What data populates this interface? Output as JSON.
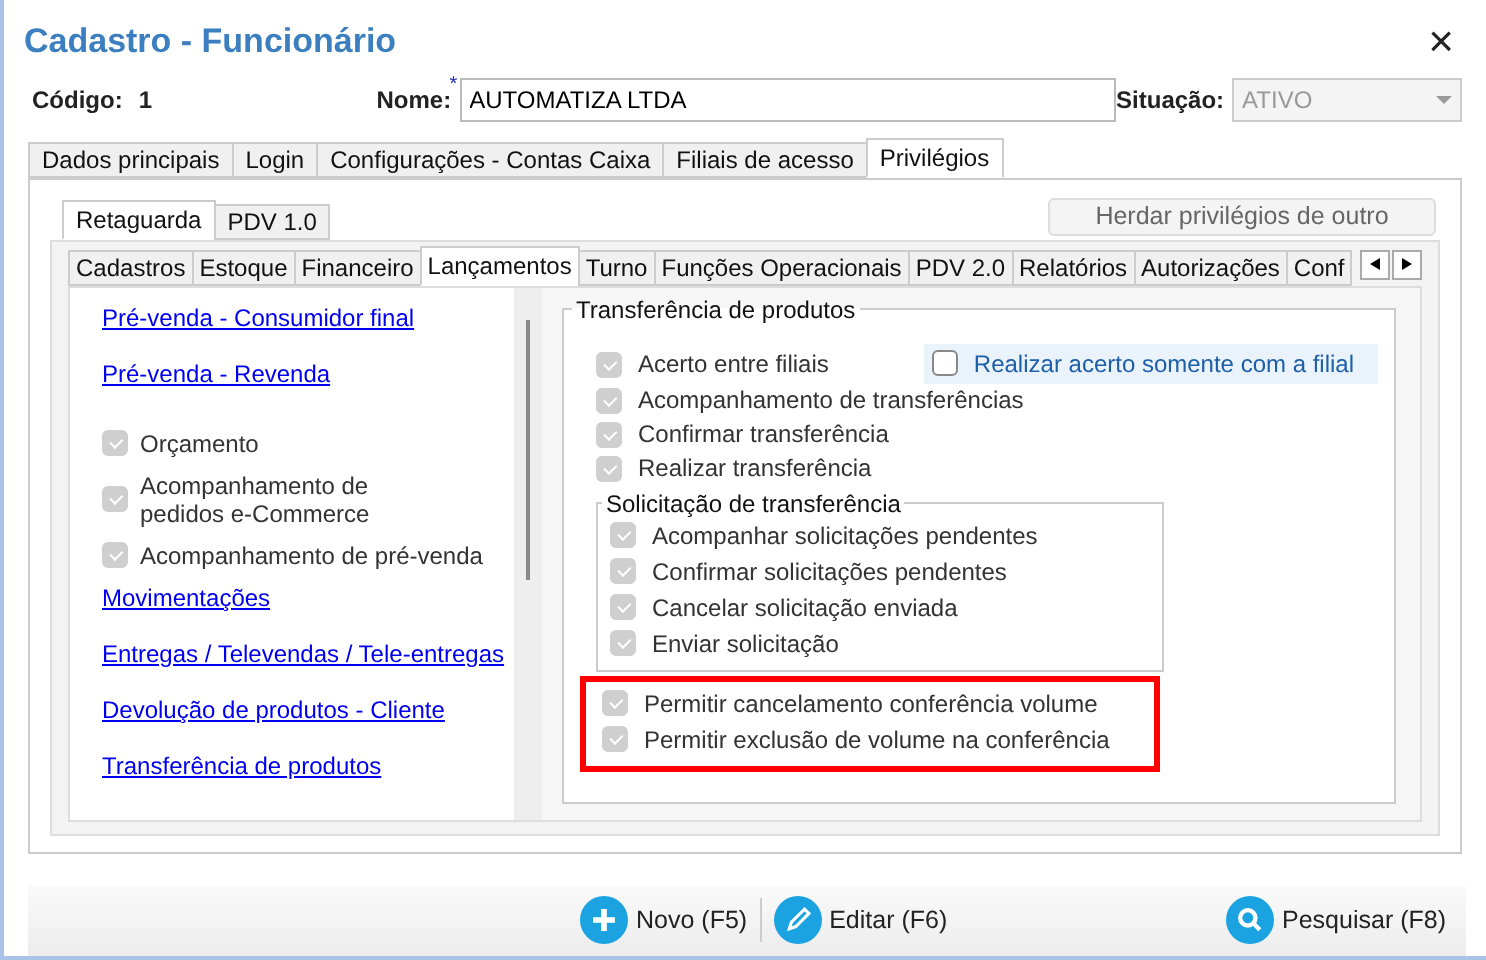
{
  "window": {
    "title": "Cadastro - Funcionário",
    "close": "×"
  },
  "fields": {
    "codigo_label": "Código:",
    "codigo_value": "1",
    "nome_label": "Nome:",
    "nome_required": "*",
    "nome_value": "AUTOMATIZA LTDA",
    "situacao_label": "Situação:",
    "situacao_value": "ATIVO"
  },
  "tabs": [
    {
      "label": "Dados principais",
      "selected": false
    },
    {
      "label": "Login",
      "selected": false
    },
    {
      "label": "Configurações - Contas Caixa",
      "selected": false
    },
    {
      "label": "Filiais de acesso",
      "selected": false
    },
    {
      "label": "Privilégios",
      "selected": true
    }
  ],
  "subtabs": [
    {
      "label": "Retaguarda",
      "selected": true
    },
    {
      "label": "PDV 1.0",
      "selected": false
    }
  ],
  "inherit_button": "Herdar privilégios de outro",
  "section_tabs": [
    {
      "label": "Cadastros",
      "selected": false
    },
    {
      "label": "Estoque",
      "selected": false
    },
    {
      "label": "Financeiro",
      "selected": false
    },
    {
      "label": "Lançamentos",
      "selected": true
    },
    {
      "label": "Turno",
      "selected": false
    },
    {
      "label": "Funções Operacionais",
      "selected": false
    },
    {
      "label": "PDV 2.0",
      "selected": false
    },
    {
      "label": "Relatórios",
      "selected": false
    },
    {
      "label": "Autorizações",
      "selected": false
    },
    {
      "label": "Conf",
      "selected": false
    }
  ],
  "sidebar": {
    "items": [
      {
        "kind": "link",
        "label": "Pré-venda - Consumidor final"
      },
      {
        "kind": "link",
        "label": "Pré-venda - Revenda"
      },
      {
        "kind": "check",
        "label": "Orçamento",
        "checked": true
      },
      {
        "kind": "check",
        "label": "Acompanhamento de pedidos e-Commerce",
        "checked": true
      },
      {
        "kind": "check",
        "label": "Acompanhamento de pré-venda",
        "checked": true
      },
      {
        "kind": "link",
        "label": "Movimentações"
      },
      {
        "kind": "link",
        "label": "Entregas / Televendas / Tele-entregas"
      },
      {
        "kind": "link",
        "label": "Devolução de produtos - Cliente"
      },
      {
        "kind": "link",
        "label": "Transferência de produtos"
      }
    ]
  },
  "transfer": {
    "title": "Transferência de produtos",
    "filial_option": {
      "label": "Realizar acerto somente com a filial",
      "checked": false
    },
    "items": [
      {
        "label": "Acerto entre filiais",
        "checked": true
      },
      {
        "label": "Acompanhamento de transferências",
        "checked": true
      },
      {
        "label": "Confirmar transferência",
        "checked": true
      },
      {
        "label": "Realizar transferência",
        "checked": true
      }
    ],
    "request": {
      "title": "Solicitação de transferência",
      "items": [
        {
          "label": "Acompanhar solicitações pendentes",
          "checked": true
        },
        {
          "label": "Confirmar solicitações pendentes",
          "checked": true
        },
        {
          "label": "Cancelar solicitação enviada",
          "checked": true
        },
        {
          "label": "Enviar solicitação",
          "checked": true
        }
      ]
    },
    "volume": {
      "highlighted": true,
      "items": [
        {
          "label": "Permitir cancelamento conferência volume",
          "checked": true
        },
        {
          "label": "Permitir exclusão de volume na conferência",
          "checked": true
        }
      ]
    }
  },
  "toolbar": [
    {
      "kind": "new",
      "label": "Novo (F5)"
    },
    {
      "kind": "edit",
      "label": "Editar (F6)"
    },
    {
      "kind": "search",
      "label": "Pesquisar (F8)"
    }
  ]
}
